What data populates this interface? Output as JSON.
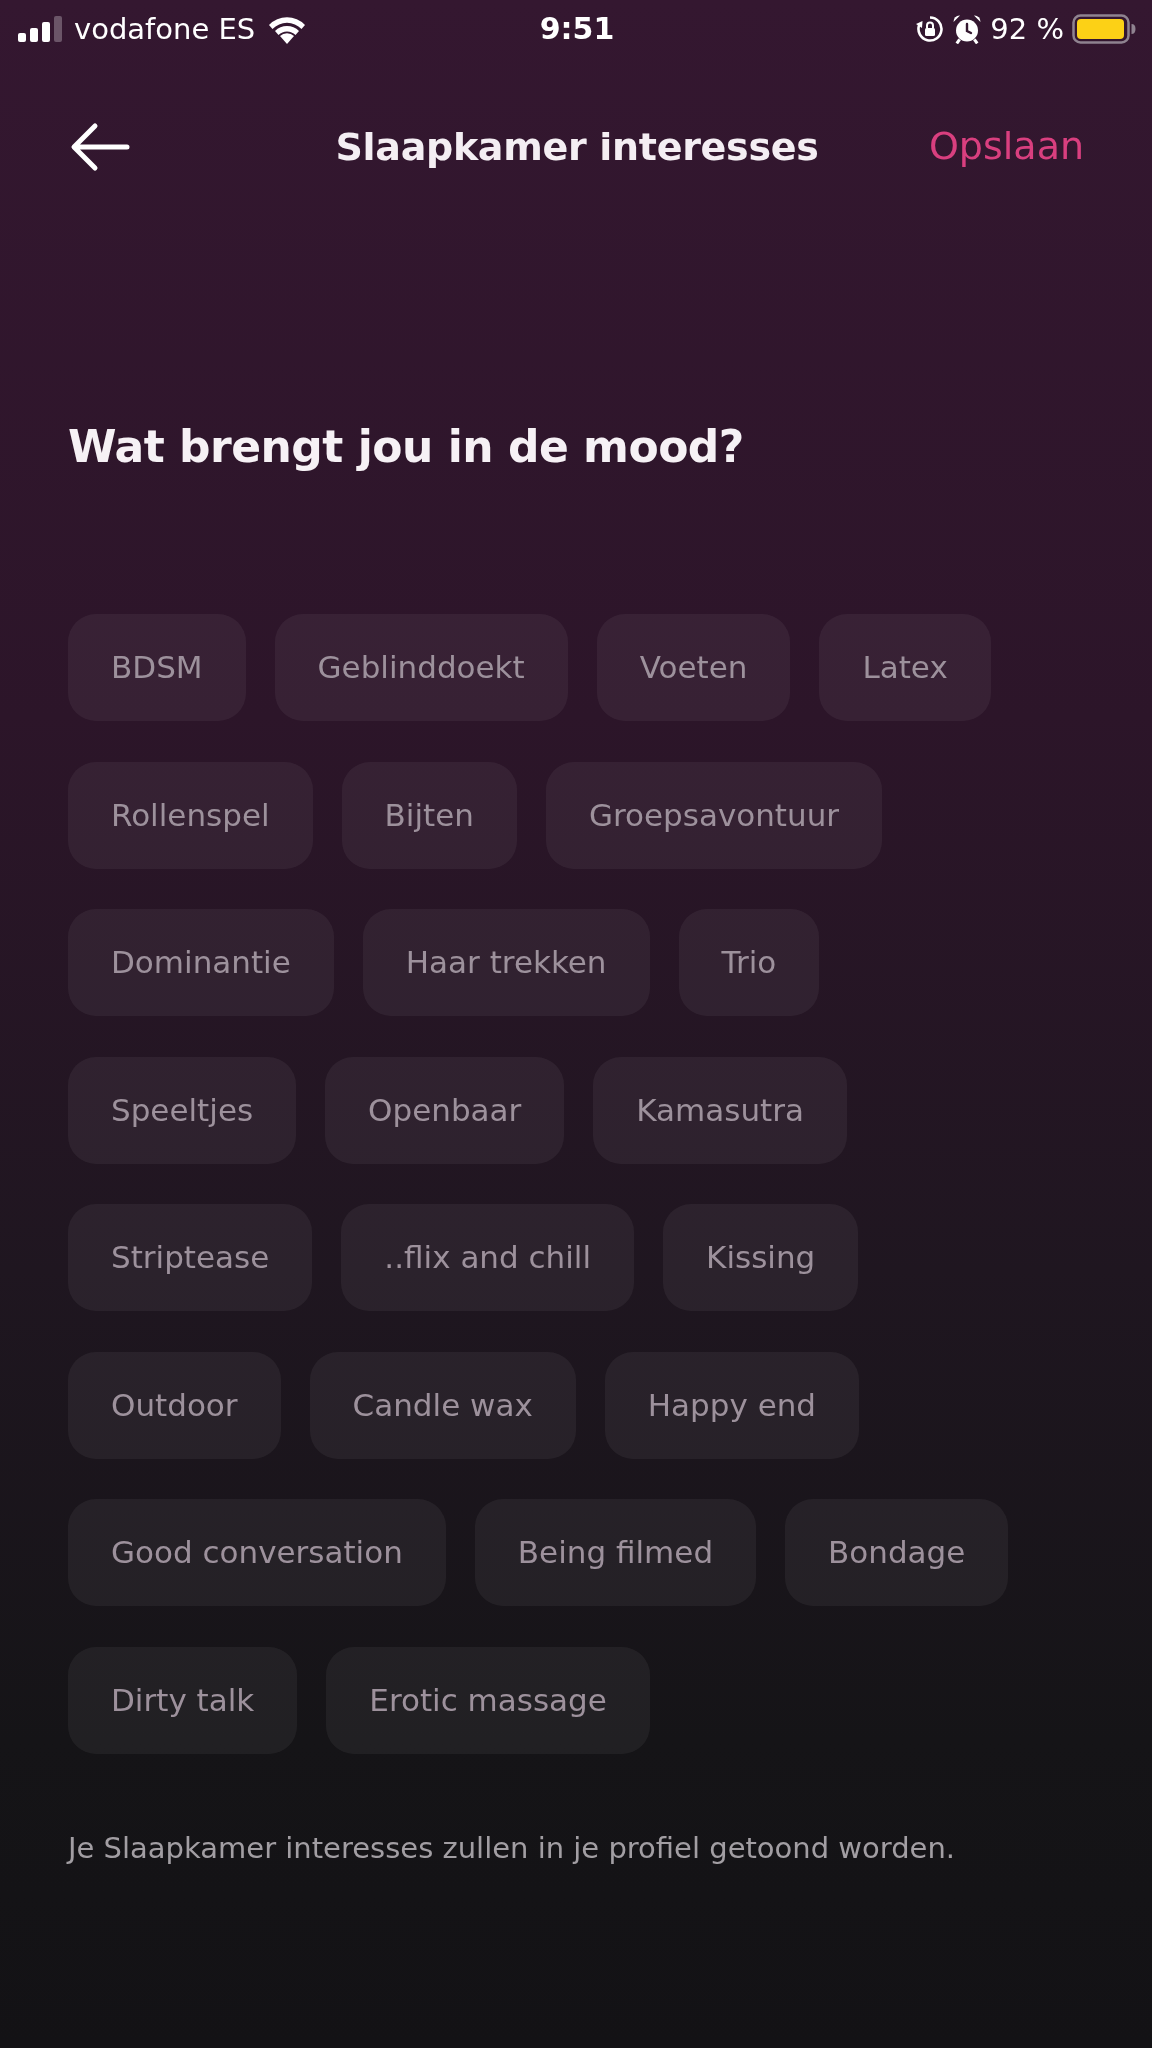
{
  "status_bar": {
    "carrier": "vodafone ES",
    "time": "9:51",
    "battery_text": "92 %"
  },
  "header": {
    "title": "Slaapkamer interesses",
    "action": "Opslaan"
  },
  "heading": "Wat brengt jou in de mood?",
  "interest_rows": [
    [
      {
        "label": "BDSM",
        "selected": false
      },
      {
        "label": "Geblinddoekt",
        "selected": false
      },
      {
        "label": "Voeten",
        "selected": false
      },
      {
        "label": "Latex",
        "selected": false
      }
    ],
    [
      {
        "label": "Rollenspel",
        "selected": false
      },
      {
        "label": "Bijten",
        "selected": false
      },
      {
        "label": "Groepsavontuur",
        "selected": false
      }
    ],
    [
      {
        "label": "Dominantie",
        "selected": false
      },
      {
        "label": "Haar trekken",
        "selected": false
      },
      {
        "label": "Trio",
        "selected": false
      }
    ],
    [
      {
        "label": "Speeltjes",
        "selected": false
      },
      {
        "label": "Openbaar",
        "selected": false
      },
      {
        "label": "Kamasutra",
        "selected": false
      }
    ],
    [
      {
        "label": "Striptease",
        "selected": false
      },
      {
        "label": "..flix and chill",
        "selected": false
      },
      {
        "label": "Kissing",
        "selected": false
      }
    ],
    [
      {
        "label": "Outdoor",
        "selected": false
      },
      {
        "label": "Candle wax",
        "selected": false
      },
      {
        "label": "Happy end",
        "selected": false
      }
    ],
    [
      {
        "label": "Good conversation",
        "selected": false
      },
      {
        "label": "Being filmed",
        "selected": false
      },
      {
        "label": "Bondage",
        "selected": false
      }
    ],
    [
      {
        "label": "Dirty talk",
        "selected": false
      },
      {
        "label": "Erotic massage",
        "selected": false
      }
    ]
  ],
  "footer_note": "Je Slaapkamer interesses zullen in je profiel getoond worden."
}
